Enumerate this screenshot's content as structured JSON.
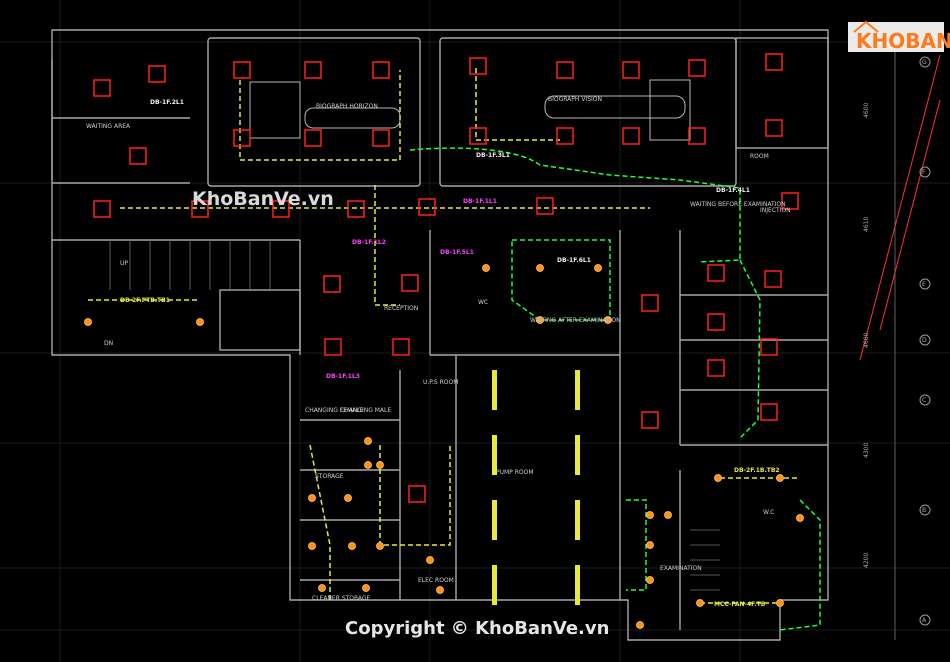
{
  "logo": {
    "text": "KHOBANVE",
    "color": "#ff7a1a"
  },
  "watermarks": {
    "center": "KhoBanVe.vn",
    "footer": "Copyright © KhoBanVe.vn"
  },
  "room_labels": [
    "BIOGRAPH HORIZON",
    "BIOGRAPH VISION",
    "WAITING AREA",
    "RECEPTION",
    "WC",
    "WAITING AFTER EXAMINATION",
    "WAITING BEFORE EXAMINATION",
    "EXAMINATION",
    "INJECTION",
    "UP",
    "DN",
    "U.P.S ROOM",
    "PUMP ROOM",
    "CHANGING FEMALE",
    "CHANGING MALE",
    "STORAGE",
    "CLEANER STORAGE",
    "ELEC ROOM",
    "ROOM",
    "W.C"
  ],
  "panel_tags": {
    "DB-1F.2L1": "DB-1F.2L1",
    "DB-1F.3L1": "DB-1F.3L1",
    "DB-1F.1L1": "DB-1F.1L1",
    "DB-1F.1L2": "DB-1F.1L2",
    "DB-1F.1L3": "DB-1F.1L3",
    "DB-1F.4L1": "DB-1F.4L1",
    "DB-1F.5L1": "DB-1F.5L1",
    "DB-1F.6L1": "DB-1F.6L1",
    "DB-2F.PTB.TB1": "DB-2F.PTB.TB1",
    "DB-2F.1B.TB2": "DB-2F.1B.TB2",
    "MCC-FAN-4F.TB": "MCC-FAN-4F.TB"
  },
  "axis": {
    "letters": [
      "G",
      "F",
      "E",
      "D",
      "C",
      "B",
      "A"
    ],
    "dims": [
      "4600",
      "4610",
      "4600",
      "4300",
      "4200"
    ]
  },
  "colors": {
    "wall": "#a8a8a8",
    "light_fixture": "#ff2020",
    "circuit_green": "#20ff40",
    "circuit_yellow": "#e8e840",
    "tag_magenta": "#ff40ff",
    "downlight": "#ff9020"
  }
}
